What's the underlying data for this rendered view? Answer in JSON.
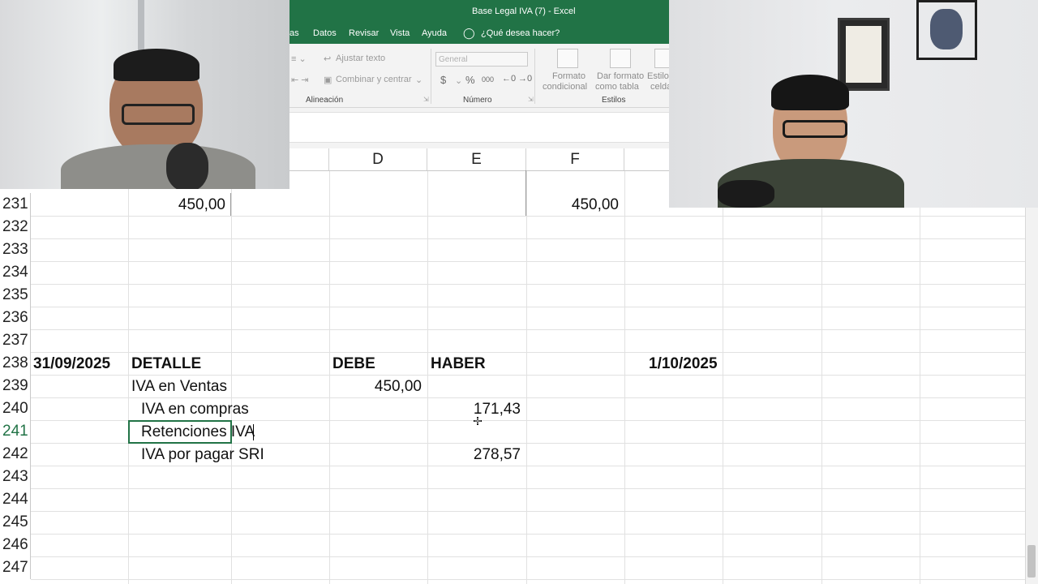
{
  "excel": {
    "window_title": "Base Legal IVA (7)  -  Excel",
    "tabs": [
      "as",
      "Datos",
      "Revisar",
      "Vista",
      "Ayuda"
    ],
    "tell_me": "¿Qué desea hacer?",
    "ribbon": {
      "wrap_text": "Ajustar texto",
      "merge_center": "Combinar y centrar",
      "alignment_group": "Alineación",
      "number_format": "General",
      "currency_symbol": "$",
      "percent_symbol": "%",
      "thousands_symbol": "000",
      "number_group": "Número",
      "conditional_format_1": "Formato",
      "conditional_format_2": "condicional",
      "format_table_1": "Dar formato",
      "format_table_2": "como tabla",
      "cell_styles_1": "Estilos",
      "cell_styles_2": "celda",
      "styles_group": "Estilos"
    },
    "column_headers": [
      "D",
      "E",
      "F"
    ]
  },
  "sheet": {
    "rows": [
      "231",
      "232",
      "233",
      "234",
      "235",
      "236",
      "237",
      "238",
      "239",
      "240",
      "241",
      "242",
      "243",
      "244",
      "245",
      "246",
      "247"
    ],
    "selected_row": "241",
    "cells": {
      "r231_b": "450,00",
      "r231_f": "450,00",
      "r238_a": "31/09/2025",
      "r238_b": "DETALLE",
      "r238_d": "DEBE",
      "r238_e": "HABER",
      "r238_g": "1/10/2025",
      "r239_b": "IVA en Ventas",
      "r239_d": "450,00",
      "r240_b": "IVA en compras",
      "r240_e": "171,43",
      "r241_b": "Retenciones IVA",
      "r242_b": "IVA por pagar SRI",
      "r242_e": "278,57"
    }
  }
}
